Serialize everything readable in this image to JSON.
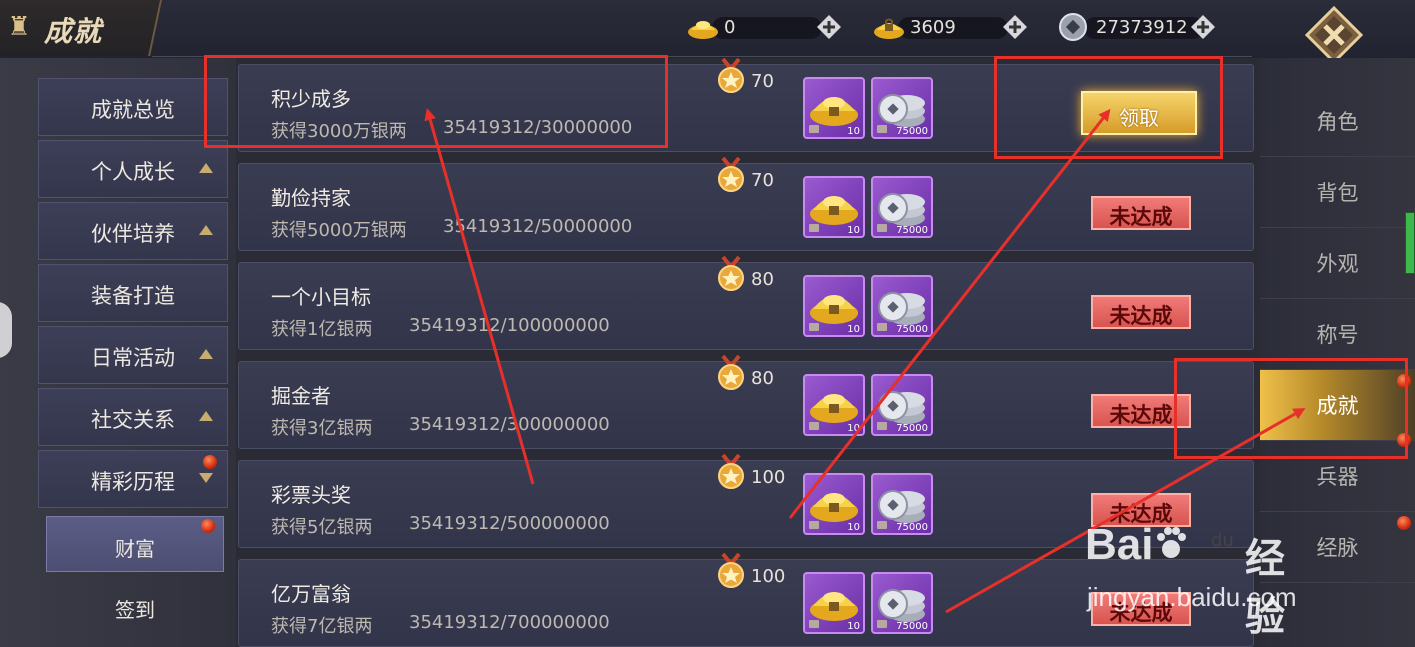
{
  "header": {
    "title": "成就",
    "currencies": [
      {
        "name": "gold-ingot-icon",
        "value": "0"
      },
      {
        "name": "bound-gold-icon",
        "value": "3609"
      },
      {
        "name": "silver-coin-icon",
        "value": "27373912"
      }
    ]
  },
  "left_nav": {
    "items": [
      {
        "label": "成就总览"
      },
      {
        "label": "个人成长"
      },
      {
        "label": "伙伴培养"
      },
      {
        "label": "装备打造"
      },
      {
        "label": "日常活动"
      },
      {
        "label": "社交关系"
      },
      {
        "label": "精彩历程"
      }
    ],
    "sub_items": [
      {
        "label": "财富",
        "active": true
      },
      {
        "label": "签到"
      }
    ]
  },
  "achievements": [
    {
      "name": "积少成多",
      "desc": "获得3000万银两",
      "progress": "35419312/30000000",
      "points": "70",
      "rewards": [
        "10",
        "75000"
      ],
      "status": "领取",
      "claimable": true
    },
    {
      "name": "勤俭持家",
      "desc": "获得5000万银两",
      "progress": "35419312/50000000",
      "points": "70",
      "rewards": [
        "10",
        "75000"
      ],
      "status": "未达成",
      "claimable": false
    },
    {
      "name": "一个小目标",
      "desc": "获得1亿银两",
      "progress": "35419312/100000000",
      "points": "80",
      "rewards": [
        "10",
        "75000"
      ],
      "status": "未达成",
      "claimable": false
    },
    {
      "name": "掘金者",
      "desc": "获得3亿银两",
      "progress": "35419312/300000000",
      "points": "80",
      "rewards": [
        "10",
        "75000"
      ],
      "status": "未达成",
      "claimable": false
    },
    {
      "name": "彩票头奖",
      "desc": "获得5亿银两",
      "progress": "35419312/500000000",
      "points": "100",
      "rewards": [
        "10",
        "75000"
      ],
      "status": "未达成",
      "claimable": false
    },
    {
      "name": "亿万富翁",
      "desc": "获得7亿银两",
      "progress": "35419312/700000000",
      "points": "100",
      "rewards": [
        "10",
        "75000"
      ],
      "status": "未达成",
      "claimable": false
    }
  ],
  "right_nav": {
    "items": [
      {
        "label": "角色"
      },
      {
        "label": "背包"
      },
      {
        "label": "外观"
      },
      {
        "label": "称号"
      },
      {
        "label": "成就",
        "active": true
      },
      {
        "label": "兵器"
      },
      {
        "label": "经脉"
      }
    ]
  },
  "watermark": {
    "logo": "Bai",
    "logo_paw": "du",
    "text": "经验",
    "url": "jingyan.baidu.com"
  },
  "colors": {
    "annotation": "#e8302a",
    "claim_button": "#e8b340",
    "status_button": "#e0605a",
    "active_tab": "#d8a840"
  }
}
